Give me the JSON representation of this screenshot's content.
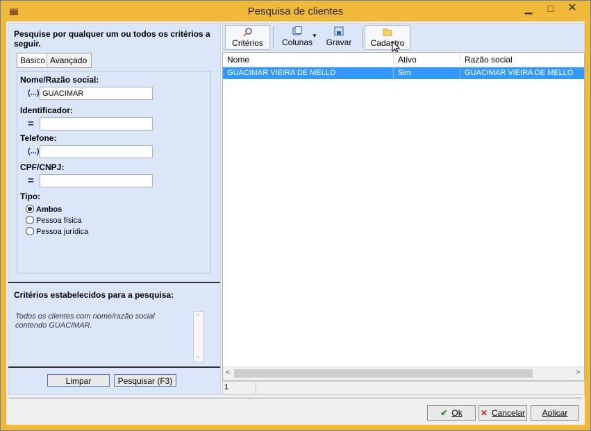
{
  "window": {
    "title": "Pesquisa de clientes",
    "min_label": "▁",
    "max_label": "□",
    "close_label": "✕"
  },
  "left": {
    "hint": "Pesquise por qualquer um ou todos os critérios a seguir.",
    "tabs": [
      "Básico",
      "Avançado"
    ],
    "fields": [
      {
        "label": "Nome/Razão social:",
        "operator": "(...)",
        "value": "GUACIMAR"
      },
      {
        "label": "Identificador:",
        "operator": "=",
        "value": ""
      },
      {
        "label": "Telefone:",
        "operator": "(...)",
        "value": ""
      },
      {
        "label": "CPF/CNPJ:",
        "operator": "=",
        "value": ""
      }
    ],
    "tipo": {
      "label": "Tipo:",
      "options": [
        "Ambos",
        "Pessoa física",
        "Pessoa jurídica"
      ],
      "selected": "Ambos"
    },
    "established_title": "Critérios estabelecidos para a pesquisa:",
    "established_text": "Todos os clientes com nome/razão social contendo GUACIMAR.",
    "buttons": {
      "clear": "Limpar",
      "search": "Pesquisar (F3)"
    }
  },
  "toolbar": {
    "criterios": "Critérios",
    "colunas": "Colunas",
    "gravar": "Gravar",
    "cadastro": "Cadastro"
  },
  "grid": {
    "headers": [
      "Nome",
      "Ativo",
      "Razão social"
    ],
    "rows": [
      [
        "GUACIMAR VIEIRA DE MELLO",
        "Sim",
        "GUACIMAR VIEIRA DE MELLO"
      ]
    ]
  },
  "status": {
    "count": "1"
  },
  "bottom": {
    "ok_label": "Ok",
    "cancel_label": "Cancelar",
    "apply_label": "Aplicar"
  },
  "colors": {
    "title_bg": "#f0b93a",
    "panel_bg": "#dbe6f8",
    "selection": "#3399ff"
  }
}
